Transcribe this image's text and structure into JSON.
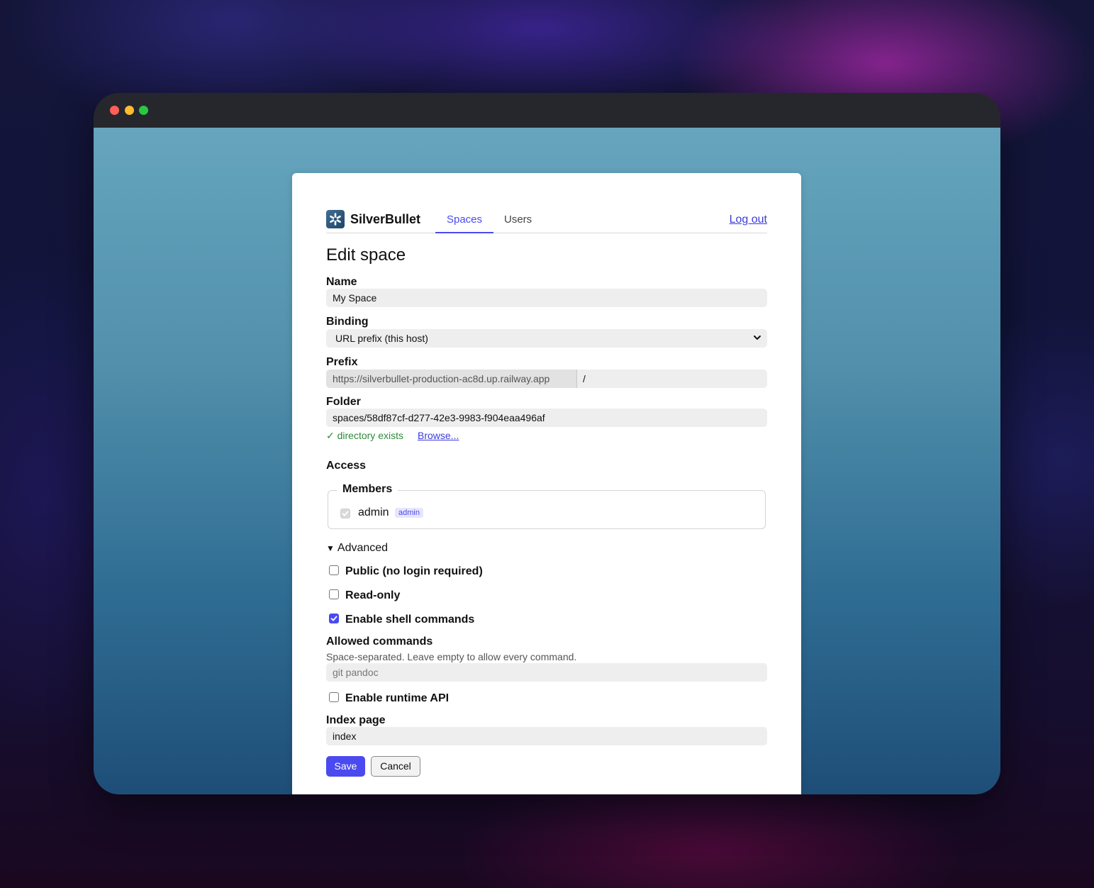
{
  "app": {
    "brand": "SilverBullet"
  },
  "nav": {
    "tabs": [
      {
        "label": "Spaces",
        "active": true
      },
      {
        "label": "Users",
        "active": false
      }
    ],
    "logout": "Log out"
  },
  "page": {
    "title": "Edit space"
  },
  "form": {
    "name": {
      "label": "Name",
      "value": "My Space"
    },
    "binding": {
      "label": "Binding",
      "value": "URL prefix (this host)"
    },
    "prefix": {
      "label": "Prefix",
      "host": "https://silverbullet-production-ac8d.up.railway.app",
      "separator": "/",
      "value": ""
    },
    "folder": {
      "label": "Folder",
      "value": "spaces/58df87cf-d277-42e3-9983-f904eaa496af",
      "status": "✓ directory exists",
      "browse": "Browse..."
    },
    "access": {
      "heading": "Access",
      "members_legend": "Members",
      "members": [
        {
          "name": "admin",
          "badge": "admin",
          "checked": true,
          "disabled": true
        }
      ]
    },
    "advanced": {
      "label": "Advanced",
      "public": {
        "label": "Public (no login required)",
        "checked": false
      },
      "readonly": {
        "label": "Read-only",
        "checked": false
      },
      "shell": {
        "label": "Enable shell commands",
        "checked": true
      },
      "allowed": {
        "label": "Allowed commands",
        "hint": "Space-separated. Leave empty to allow every command.",
        "placeholder": "git pandoc"
      },
      "runtime": {
        "label": "Enable runtime API",
        "checked": false
      },
      "index": {
        "label": "Index page",
        "value": "index"
      }
    },
    "buttons": {
      "save": "Save",
      "cancel": "Cancel"
    }
  },
  "colors": {
    "accent": "#4a4af0",
    "success": "#2e8b3a",
    "link": "#3b3bdb"
  }
}
